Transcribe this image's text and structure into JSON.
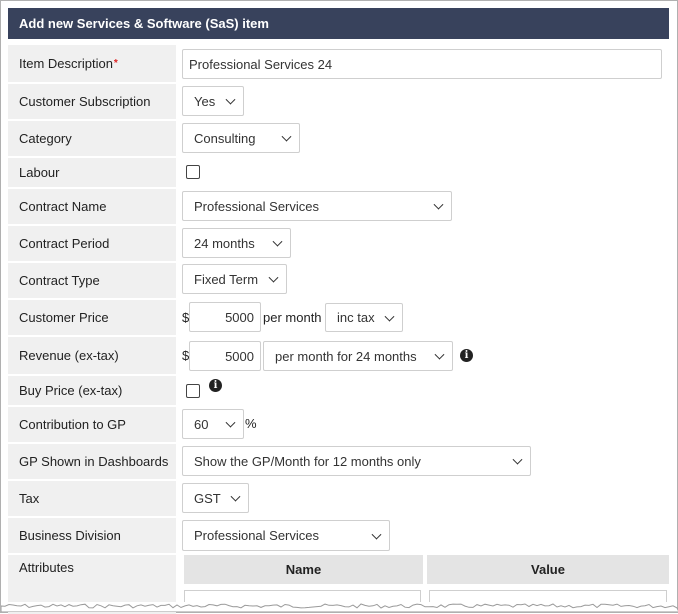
{
  "dialog": {
    "title": "Add new Services & Software (SaS) item"
  },
  "fields": {
    "item_description": {
      "label": "Item Description",
      "required_marker": "*",
      "value": "Professional Services 24"
    },
    "customer_subscription": {
      "label": "Customer Subscription",
      "value": "Yes"
    },
    "category": {
      "label": "Category",
      "value": "Consulting"
    },
    "labour": {
      "label": "Labour",
      "checked": false
    },
    "contract_name": {
      "label": "Contract Name",
      "value": "Professional Services"
    },
    "contract_period": {
      "label": "Contract Period",
      "value": "24 months"
    },
    "contract_type": {
      "label": "Contract Type",
      "value": "Fixed Term"
    },
    "customer_price": {
      "label": "Customer Price",
      "currency": "$",
      "amount": "5000",
      "unit": "per month",
      "tax_mode": "inc tax"
    },
    "revenue": {
      "label": "Revenue (ex-tax)",
      "currency": "$",
      "amount": "5000",
      "period": "per month for 24 months"
    },
    "buy_price": {
      "label": "Buy Price (ex-tax)",
      "checked": false
    },
    "contribution_to_gp": {
      "label": "Contribution to GP",
      "value": "60",
      "suffix": "%"
    },
    "gp_shown": {
      "label": "GP Shown in Dashboards",
      "value": "Show the GP/Month for 12 months only"
    },
    "tax": {
      "label": "Tax",
      "value": "GST"
    },
    "business_division": {
      "label": "Business Division",
      "value": "Professional Services"
    },
    "attributes": {
      "label": "Attributes",
      "columns": [
        "Name",
        "Value"
      ]
    }
  },
  "icons": {
    "info": "info-icon",
    "chevron": "chevron-down-icon"
  },
  "colors": {
    "title_bar": "#38425c",
    "label_bg": "#f0f0f0",
    "required": "#dd2222"
  }
}
